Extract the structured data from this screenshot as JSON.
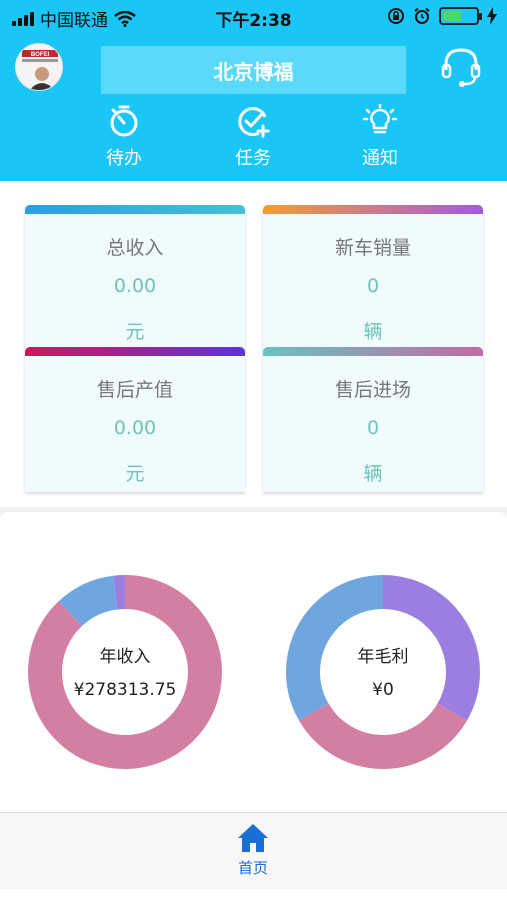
{
  "status_bar": {
    "carrier": "中国联通",
    "time": "下午2:38",
    "battery_color": "#4cd964"
  },
  "header": {
    "title": "北京博福",
    "avatar_text": "BOFEI",
    "support_icon": "headset-icon"
  },
  "nav": [
    {
      "label": "待办",
      "icon": "stopwatch-icon"
    },
    {
      "label": "任务",
      "icon": "check-circle-plus-icon"
    },
    {
      "label": "通知",
      "icon": "lightbulb-icon"
    }
  ],
  "cards": [
    {
      "label": "总收入",
      "value": "0.00",
      "unit": "元",
      "bar_from": "#2a9fe0",
      "bar_to": "#45bfd6"
    },
    {
      "label": "新车销量",
      "value": "0",
      "unit": "辆",
      "bar_from": "#f39c32",
      "bar_to": "#a35be0"
    },
    {
      "label": "售后产值",
      "value": "0.00",
      "unit": "元",
      "bar_from": "#d4145a",
      "bar_to": "#5b36d6"
    },
    {
      "label": "售后进场",
      "value": "0",
      "unit": "辆",
      "bar_from": "#68c4c0",
      "bar_to": "#c16aa6"
    }
  ],
  "charts": [
    {
      "title": "年收入",
      "value": "¥278313.75",
      "segments": [
        {
          "fraction": 0.88,
          "color": "#d27fa3"
        },
        {
          "fraction": 0.1,
          "color": "#6fa6e0"
        },
        {
          "fraction": 0.02,
          "color": "#9b7fe0"
        }
      ]
    },
    {
      "title": "年毛利",
      "value": "¥0",
      "segments": [
        {
          "fraction": 0.3333,
          "color": "#9b7fe0"
        },
        {
          "fraction": 0.3333,
          "color": "#d27fa3"
        },
        {
          "fraction": 0.3334,
          "color": "#6fa6e0"
        }
      ]
    }
  ],
  "tabbar": {
    "home_label": "首页",
    "accent": "#1a6fd6"
  }
}
